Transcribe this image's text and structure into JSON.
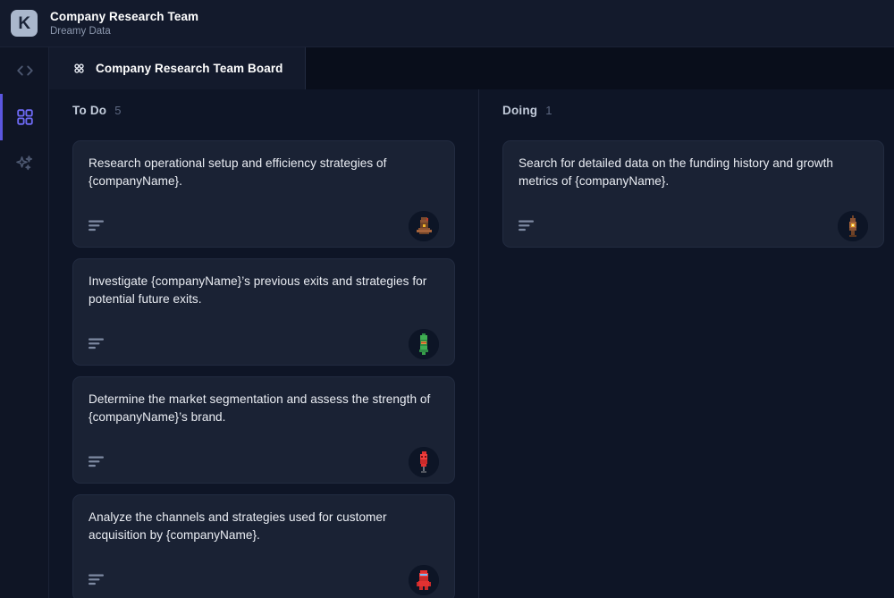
{
  "header": {
    "logo_letter": "K",
    "title": "Company Research Team",
    "subtitle": "Dreamy Data"
  },
  "rail": {
    "items": [
      {
        "name": "code-icon",
        "label": "Code",
        "active": false
      },
      {
        "name": "board-icon",
        "label": "Board",
        "active": true
      },
      {
        "name": "sparkles-icon",
        "label": "AI Assistant",
        "active": false
      }
    ]
  },
  "tabs": [
    {
      "icon": "grid-dots-icon",
      "label": "Company Research Team  Board",
      "active": true
    }
  ],
  "colors": {
    "accent": "#6e6af5",
    "page_bg": "#0e1526",
    "card_bg": "#1a2234",
    "header_bg": "#131a2c",
    "tabstrip_bg": "#090e1b"
  },
  "board": {
    "columns": [
      {
        "title": "To Do",
        "count": "5",
        "cards": [
          {
            "text": "Research operational setup and efficiency strategies of {companyName}.",
            "has_description": true,
            "avatar": "avatar-brown-hat"
          },
          {
            "text": "Investigate {companyName}’s previous exits and strategies for potential future exits.",
            "has_description": true,
            "avatar": "avatar-green-robot"
          },
          {
            "text": "Determine the market segmentation and assess the strength of {companyName}’s brand.",
            "has_description": true,
            "avatar": "avatar-red-torch"
          },
          {
            "text": "Analyze the channels and strategies used for customer acquisition by {companyName}.",
            "has_description": true,
            "avatar": "avatar-red-suit"
          }
        ]
      },
      {
        "title": "Doing",
        "count": "1",
        "cards": [
          {
            "text": "Search for detailed data on the funding history and growth metrics of {companyName}.",
            "has_description": true,
            "avatar": "avatar-brown-lamp"
          }
        ]
      }
    ]
  }
}
